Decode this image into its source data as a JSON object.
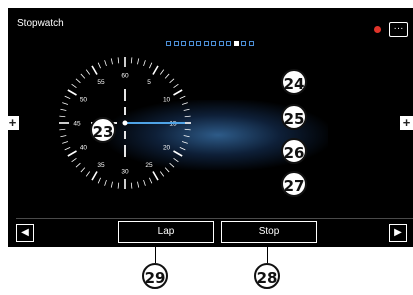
{
  "header": {
    "title": "Stopwatch",
    "menu_icon": "ellipsis-icon",
    "menu_label": "···"
  },
  "status": {
    "recording_color": "#e0342a"
  },
  "pager": {
    "page_count": 12,
    "active_page": 9
  },
  "dial": {
    "labels": [
      "60",
      "5",
      "10",
      "15",
      "20",
      "25",
      "30",
      "35",
      "40",
      "45",
      "50",
      "55"
    ],
    "hand_color": "#4fa3e6"
  },
  "side_tabs": {
    "left": "+",
    "right": "+"
  },
  "callouts": {
    "c23": "23",
    "c24": "24",
    "c25": "25",
    "c26": "26",
    "c27": "27",
    "c28": "28",
    "c29": "29"
  },
  "buttons": {
    "lap": "Lap",
    "stop": "Stop",
    "prev_icon": "triangle-left-icon",
    "next_icon": "triangle-right-icon",
    "prev_glyph": "◀",
    "next_glyph": "▶"
  }
}
